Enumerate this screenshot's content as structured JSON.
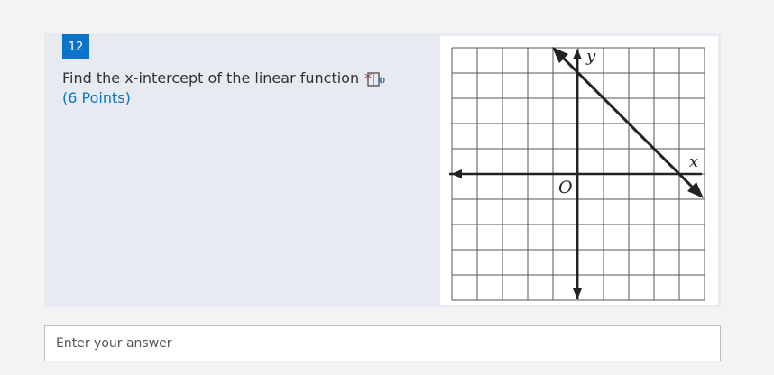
{
  "question": {
    "number": "12",
    "text": "Find the x-intercept of the linear function",
    "required_mark": "*",
    "points": "(6 Points)",
    "reader_icon": "immersive-reader-icon"
  },
  "graph": {
    "y_label": "y",
    "x_label": "x",
    "origin_label": "O",
    "grid": true
  },
  "answer": {
    "placeholder": "Enter your answer",
    "value": ""
  }
}
